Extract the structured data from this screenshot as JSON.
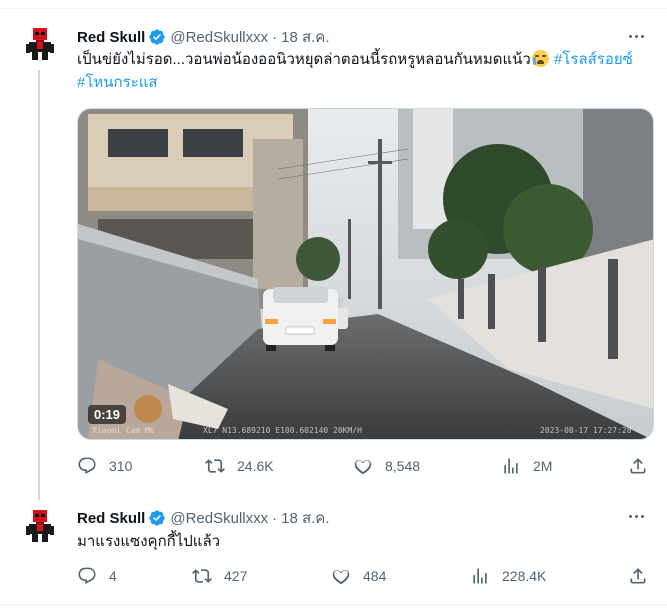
{
  "tweets": [
    {
      "name": "Red Skull",
      "handle": "@RedSkullxxx",
      "separator": "·",
      "date": "18 ส.ค.",
      "text": "เป็นข่ยังไม่รอด...วอนพ่อน้องออนิวหยุดล่าตอนนี้รถหรูหลอนกันหมดแน้ว",
      "emoji": "crying-face",
      "hashtags": [
        "#โรลส์รอยซ์",
        "#โหนกระแส"
      ],
      "video": {
        "duration": "0:19",
        "osd_left": "Xiaomi Cam M6",
        "osd_mid": "XL7 N13.689210 E100.602140 20KM/H",
        "osd_right": "2023-08-17 17:27:28"
      },
      "stats": {
        "replies": "310",
        "reposts": "24.6K",
        "likes": "8,548",
        "views": "2M"
      }
    },
    {
      "name": "Red Skull",
      "handle": "@RedSkullxxx",
      "separator": "·",
      "date": "18 ส.ค.",
      "text": "มาแรงแซงคุกกี้ไปแล้ว",
      "stats": {
        "replies": "4",
        "reposts": "427",
        "likes": "484",
        "views": "228.4K"
      }
    }
  ],
  "colors": {
    "verified": "#1d9bf0",
    "hashtag": "#1d9bf0",
    "muted": "#536471",
    "text": "#0f1419",
    "avatar_red": "#d4141c"
  },
  "icons": [
    "red-skull-avatar",
    "verified-badge-icon",
    "more-icon",
    "reply-icon",
    "repost-icon",
    "like-icon",
    "views-icon",
    "share-icon"
  ]
}
